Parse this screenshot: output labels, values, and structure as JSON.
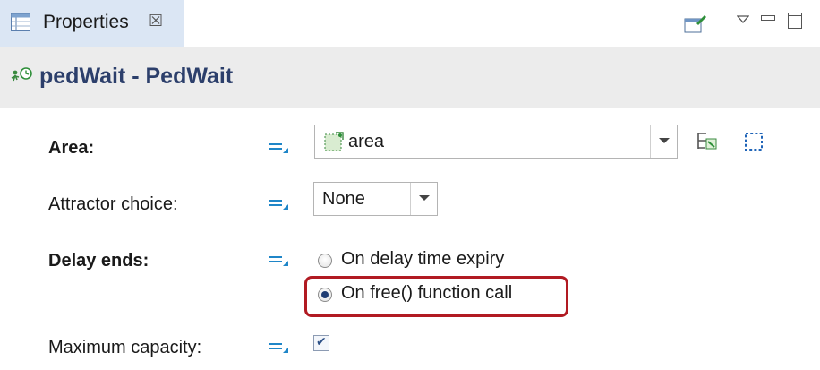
{
  "tab": {
    "label": "Properties",
    "close_glyph": "☒"
  },
  "header": {
    "title": "pedWait - PedWait"
  },
  "fields": {
    "area": {
      "label": "Area:",
      "value": "area"
    },
    "attractor": {
      "label": "Attractor choice:",
      "value": "None"
    },
    "delay": {
      "label": "Delay ends:",
      "options": [
        {
          "label": "On delay time expiry",
          "selected": false
        },
        {
          "label": "On free() function call",
          "selected": true
        }
      ]
    },
    "capacity": {
      "label": "Maximum capacity:",
      "checked": true,
      "check_glyph": "✔"
    }
  },
  "colors": {
    "title": "#2c3f6b",
    "highlight": "#b11a22",
    "accent": "#1f86c8"
  },
  "icons": [
    "properties-tab-icon",
    "close-icon",
    "new-view-icon",
    "view-menu-icon",
    "minimize-icon",
    "maximize-icon",
    "agent-wait-icon",
    "equals-icon",
    "area-shape-icon",
    "select-area-icon",
    "area-region-icon"
  ]
}
